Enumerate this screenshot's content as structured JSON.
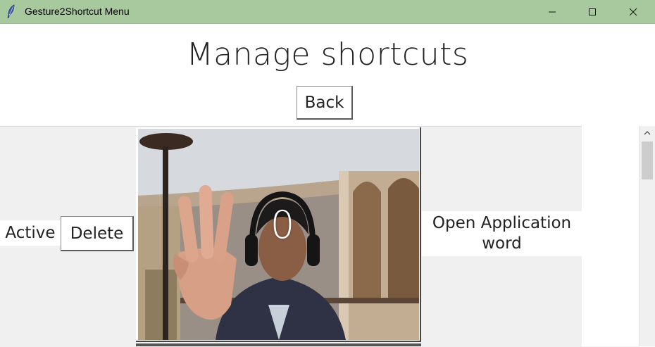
{
  "window": {
    "title": "Gesture2Shortcut Menu",
    "icon": "feather-icon",
    "controls": [
      "minimize-icon",
      "maximize-icon",
      "close-icon"
    ]
  },
  "page": {
    "heading": "Manage shortcuts",
    "back_label": "Back"
  },
  "shortcuts": [
    {
      "status": "Active",
      "delete_label": "Delete",
      "gesture_label": "0",
      "action_line1": "Open Application",
      "action_line2": "word"
    }
  ],
  "colors": {
    "titlebar": "#a8c99e",
    "list_background": "#f0f0f0",
    "text": "#222222"
  }
}
